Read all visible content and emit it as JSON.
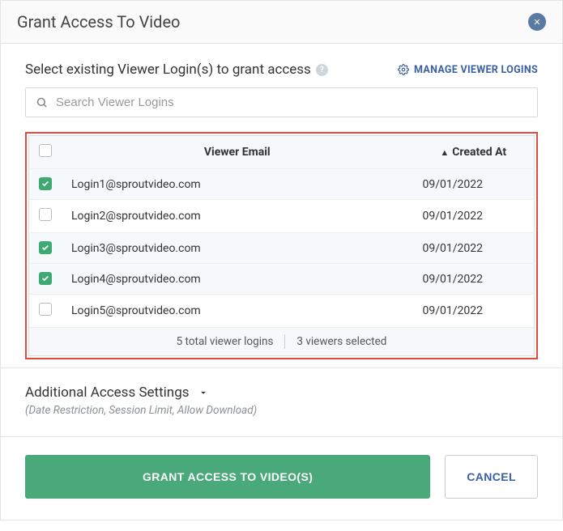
{
  "modal": {
    "title": "Grant Access To Video",
    "select_label": "Select existing Viewer Login(s) to grant access",
    "manage_link": "MANAGE VIEWER LOGINS",
    "search_placeholder": "Search Viewer Logins"
  },
  "table": {
    "headers": {
      "email": "Viewer Email",
      "created": "Created At"
    },
    "rows": [
      {
        "email": "Login1@sproutvideo.com",
        "created": "09/01/2022",
        "checked": true
      },
      {
        "email": "Login2@sproutvideo.com",
        "created": "09/01/2022",
        "checked": false
      },
      {
        "email": "Login3@sproutvideo.com",
        "created": "09/01/2022",
        "checked": true
      },
      {
        "email": "Login4@sproutvideo.com",
        "created": "09/01/2022",
        "checked": true
      },
      {
        "email": "Login5@sproutvideo.com",
        "created": "09/01/2022",
        "checked": false
      }
    ],
    "footer": {
      "total": "5 total viewer logins",
      "selected": "3 viewers selected"
    }
  },
  "settings": {
    "title": "Additional Access Settings",
    "subtitle": "(Date Restriction, Session Limit, Allow Download)"
  },
  "footer": {
    "grant": "GRANT ACCESS TO VIDEO(S)",
    "cancel": "CANCEL"
  }
}
